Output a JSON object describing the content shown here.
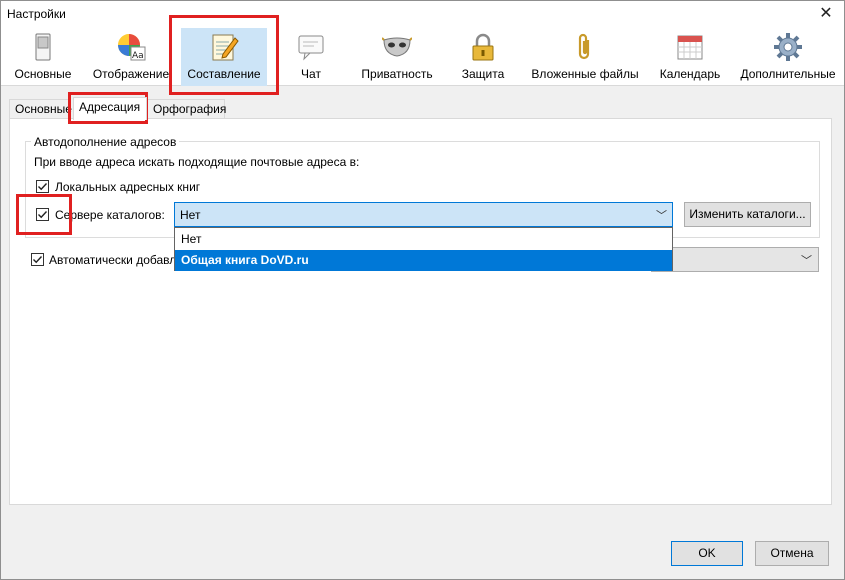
{
  "window": {
    "title": "Настройки",
    "close_glyph": "✕"
  },
  "toolbar": {
    "items": [
      {
        "label": "Основные",
        "icon": "switch-icon"
      },
      {
        "label": "Отображение",
        "icon": "palette-icon"
      },
      {
        "label": "Составление",
        "icon": "notepad-pencil-icon",
        "selected": true
      },
      {
        "label": "Чат",
        "icon": "speech-bubble-icon"
      },
      {
        "label": "Приватность",
        "icon": "mask-icon"
      },
      {
        "label": "Защита",
        "icon": "padlock-icon"
      },
      {
        "label": "Вложенные файлы",
        "icon": "paperclip-icon"
      },
      {
        "label": "Календарь",
        "icon": "calendar-icon"
      },
      {
        "label": "Дополнительные",
        "icon": "gear-icon"
      }
    ]
  },
  "tabs": [
    {
      "label": "Основные"
    },
    {
      "label": "Адресация",
      "active": true
    },
    {
      "label": "Орфография"
    }
  ],
  "autocomplete": {
    "group_title": "Автодополнение адресов",
    "instruction": "При вводе адреса искать подходящие почтовые адреса в:",
    "local_books": {
      "label": "Локальных адресных книг",
      "checked": true
    },
    "directory_server": {
      "label": "Сервере каталогов:",
      "checked": true,
      "selected_value": "Нет",
      "edit_button": "Изменить каталоги...",
      "options": [
        "Нет",
        "Общая книга DoVD.ru"
      ],
      "highlighted_option": "Общая книга DoVD.ru"
    }
  },
  "auto_add": {
    "label": "Автоматически добавл",
    "checked": true
  },
  "buttons": {
    "ok": "OK",
    "cancel": "Отмена"
  },
  "colors": {
    "accent": "#0078d7",
    "highlight_box": "#e02020",
    "selected_tool_bg": "#cce4f7"
  }
}
